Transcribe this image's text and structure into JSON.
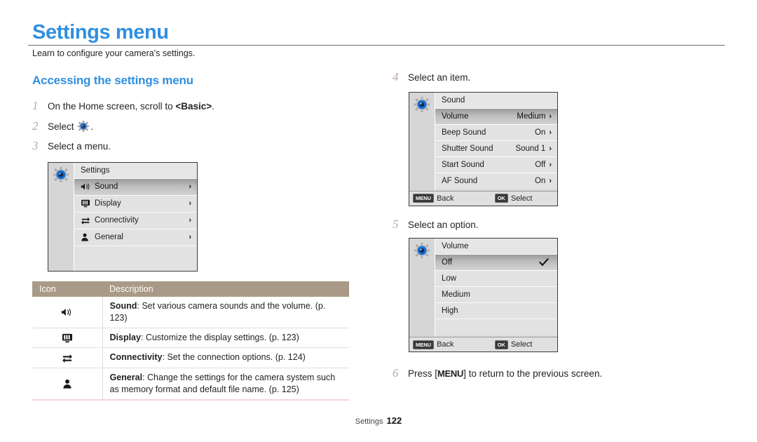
{
  "header": {
    "title": "Settings menu",
    "subtitle": "Learn to configure your camera's settings."
  },
  "left": {
    "section_title": "Accessing the settings menu",
    "steps": [
      {
        "num": "1",
        "text_before": "On the Home screen, scroll to ",
        "bold": "<Basic>",
        "text_after": "."
      },
      {
        "num": "2",
        "text_before": "Select ",
        "icon": "gear-icon",
        "text_after": "."
      },
      {
        "num": "3",
        "text_before": "Select a menu.",
        "text_after": ""
      }
    ],
    "settings_screen": {
      "title": "Settings",
      "rail_icon": "gear-icon",
      "rows": [
        {
          "icon": "speaker-icon",
          "label": "Sound",
          "chevron": "›",
          "selected": true
        },
        {
          "icon": "display-icon",
          "label": "Display",
          "chevron": "›",
          "selected": false
        },
        {
          "icon": "connectivity-icon",
          "label": "Connectivity",
          "chevron": "›",
          "selected": false
        },
        {
          "icon": "person-icon",
          "label": "General",
          "chevron": "›",
          "selected": false
        }
      ]
    },
    "table": {
      "headers": [
        "Icon",
        "Description"
      ],
      "header_color": "#a89a86",
      "rows": [
        {
          "icon": "speaker-icon",
          "term": "Sound",
          "desc": ": Set various camera sounds and the volume. (p. 123)"
        },
        {
          "icon": "display-icon",
          "term": "Display",
          "desc": ": Customize the display settings. (p. 123)"
        },
        {
          "icon": "connectivity-icon",
          "term": "Connectivity",
          "desc": ": Set the connection options. (p. 124)"
        },
        {
          "icon": "person-icon",
          "term": "General",
          "desc": ": Change the settings for the camera system such as memory format and default file name. (p. 125)"
        }
      ]
    }
  },
  "right": {
    "step4": {
      "num": "4",
      "text": "Select an item."
    },
    "sound_screen": {
      "title": "Sound",
      "rail_icon": "gear-icon",
      "rows": [
        {
          "label": "Volume",
          "value": "Medium",
          "chevron": "›",
          "selected": true
        },
        {
          "label": "Beep Sound",
          "value": "On",
          "chevron": "›",
          "selected": false
        },
        {
          "label": "Shutter Sound",
          "value": "Sound 1",
          "chevron": "›",
          "selected": false
        },
        {
          "label": "Start Sound",
          "value": "Off",
          "chevron": "›",
          "selected": false
        },
        {
          "label": "AF Sound",
          "value": "On",
          "chevron": "›",
          "selected": false
        }
      ],
      "footer": {
        "menu_key": "MENU",
        "menu_label": "Back",
        "ok_key": "OK",
        "ok_label": "Select"
      }
    },
    "step5": {
      "num": "5",
      "text": "Select an option."
    },
    "volume_screen": {
      "title": "Volume",
      "rail_icon": "gear-icon",
      "rows": [
        {
          "label": "Off",
          "check": true,
          "selected": true
        },
        {
          "label": "Low",
          "check": false,
          "selected": false
        },
        {
          "label": "Medium",
          "check": false,
          "selected": false
        },
        {
          "label": "High",
          "check": false,
          "selected": false
        },
        {
          "label": "",
          "check": false,
          "selected": false
        }
      ],
      "footer": {
        "menu_key": "MENU",
        "menu_label": "Back",
        "ok_key": "OK",
        "ok_label": "Select"
      }
    },
    "step6": {
      "num": "6",
      "text_before": "Press [",
      "key": "MENU",
      "text_after": "] to return to the previous screen."
    }
  },
  "footer": {
    "label": "Settings",
    "page": "122"
  }
}
